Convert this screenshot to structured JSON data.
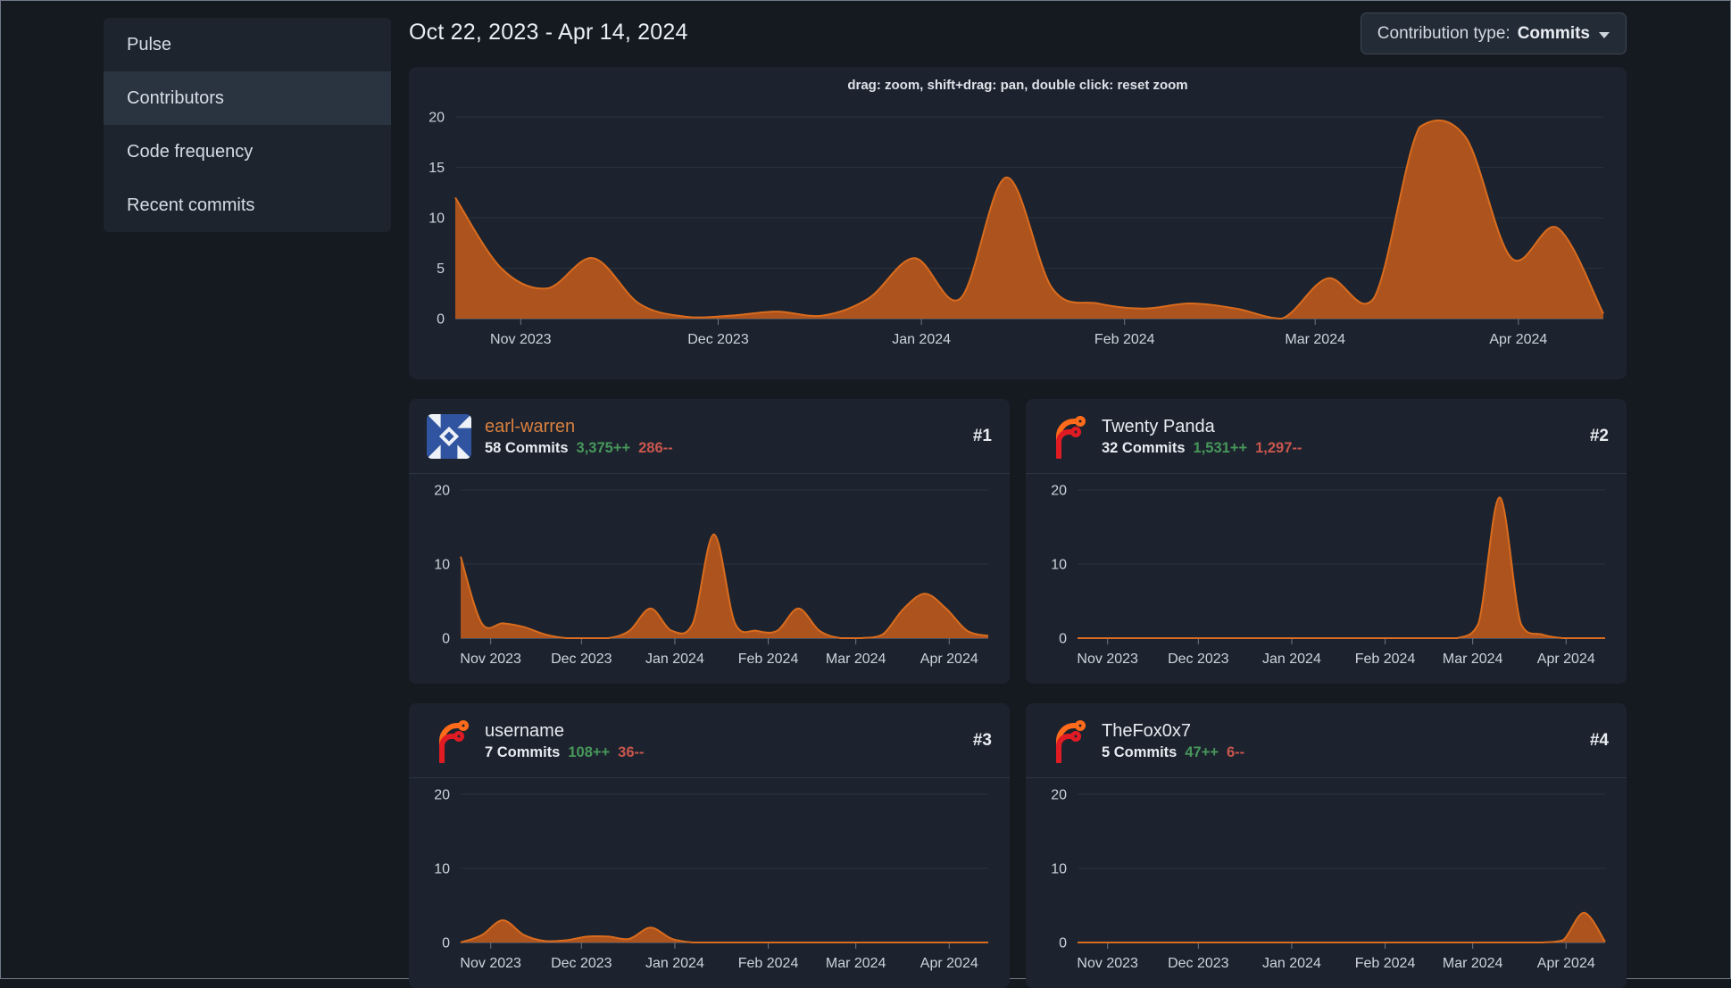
{
  "theme": {
    "page_bg": "#151a21",
    "panel_bg": "#1c232e",
    "chart_fill": "#b5561e",
    "chart_stroke": "#d96c1e",
    "link_orange": "#d9803f",
    "additions_green": "#47975a",
    "deletions_red": "#c9564e"
  },
  "sidebar": {
    "items": [
      {
        "label": "Pulse",
        "active": false
      },
      {
        "label": "Contributors",
        "active": true
      },
      {
        "label": "Code frequency",
        "active": false
      },
      {
        "label": "Recent commits",
        "active": false
      }
    ]
  },
  "header": {
    "date_range": "Oct 22, 2023 - Apr 14, 2024",
    "contribution_type_label": "Contribution type:",
    "contribution_type_value": "Commits"
  },
  "contributors": [
    {
      "rank": "#1",
      "name": "earl-warren",
      "commits": "58 Commits",
      "additions": "3,375++",
      "deletions": "286--",
      "avatar": "identicon"
    },
    {
      "rank": "#2",
      "name": "Twenty Panda",
      "commits": "32 Commits",
      "additions": "1,531++",
      "deletions": "1,297--",
      "avatar": "forgejo-logo"
    },
    {
      "rank": "#3",
      "name": "username",
      "commits": "7 Commits",
      "additions": "108++",
      "deletions": "36--",
      "avatar": "forgejo-logo"
    },
    {
      "rank": "#4",
      "name": "TheFox0x7",
      "commits": "5 Commits",
      "additions": "47++",
      "deletions": "6--",
      "avatar": "forgejo-logo"
    }
  ],
  "chart_data": [
    {
      "id": "all-contributions",
      "type": "area",
      "hint": "drag: zoom, shift+drag: pan, double click: reset zoom",
      "x_labels": [
        "Nov 2023",
        "Dec 2023",
        "Jan 2024",
        "Feb 2024",
        "Mar 2024",
        "Apr 2024"
      ],
      "x_unit": "week",
      "ylim": [
        0,
        20
      ],
      "y_ticks": [
        0,
        5,
        10,
        15,
        20
      ],
      "values": [
        12,
        5,
        3,
        6,
        1.5,
        0.2,
        0.3,
        0.7,
        0.3,
        2,
        6,
        2,
        14,
        3,
        1.5,
        1,
        1.5,
        1,
        0,
        4,
        2,
        19,
        18,
        6,
        9,
        0.5
      ]
    },
    {
      "id": "earl-warren-commits",
      "type": "area",
      "x_labels": [
        "Nov 2023",
        "Dec 2023",
        "Jan 2024",
        "Feb 2024",
        "Mar 2024",
        "Apr 2024"
      ],
      "ylim": [
        0,
        20
      ],
      "y_ticks": [
        0,
        10,
        20
      ],
      "values": [
        11,
        2,
        2,
        1.5,
        0.5,
        0,
        0,
        0,
        1,
        4,
        1,
        2,
        14,
        2,
        1,
        1,
        4,
        1,
        0,
        0,
        0.5,
        4,
        6,
        4,
        1,
        0.3
      ]
    },
    {
      "id": "twenty-panda-commits",
      "type": "area",
      "x_labels": [
        "Nov 2023",
        "Dec 2023",
        "Jan 2024",
        "Feb 2024",
        "Mar 2024",
        "Apr 2024"
      ],
      "ylim": [
        0,
        20
      ],
      "y_ticks": [
        0,
        10,
        20
      ],
      "values": [
        0,
        0,
        0,
        0,
        0,
        0,
        0,
        0,
        0,
        0,
        0,
        0,
        0,
        0,
        0,
        0,
        0,
        0,
        0,
        2,
        19,
        2,
        0.5,
        0,
        0,
        0
      ]
    },
    {
      "id": "username-commits",
      "type": "area",
      "x_labels": [
        "Nov 2023",
        "Dec 2023",
        "Jan 2024",
        "Feb 2024",
        "Mar 2024",
        "Apr 2024"
      ],
      "ylim": [
        0,
        20
      ],
      "y_ticks": [
        0,
        10,
        20
      ],
      "values": [
        0,
        1,
        3,
        1,
        0.2,
        0.3,
        0.8,
        0.8,
        0.5,
        2,
        0.5,
        0,
        0,
        0,
        0,
        0,
        0,
        0,
        0,
        0,
        0,
        0,
        0,
        0,
        0,
        0
      ]
    },
    {
      "id": "thefox0x7-commits",
      "type": "area",
      "x_labels": [
        "Nov 2023",
        "Dec 2023",
        "Jan 2024",
        "Feb 2024",
        "Mar 2024",
        "Apr 2024"
      ],
      "ylim": [
        0,
        20
      ],
      "y_ticks": [
        0,
        10,
        20
      ],
      "values": [
        0,
        0,
        0,
        0,
        0,
        0,
        0,
        0,
        0,
        0,
        0,
        0,
        0,
        0,
        0,
        0,
        0,
        0,
        0,
        0,
        0,
        0,
        0,
        0.3,
        4,
        0.1
      ]
    }
  ]
}
